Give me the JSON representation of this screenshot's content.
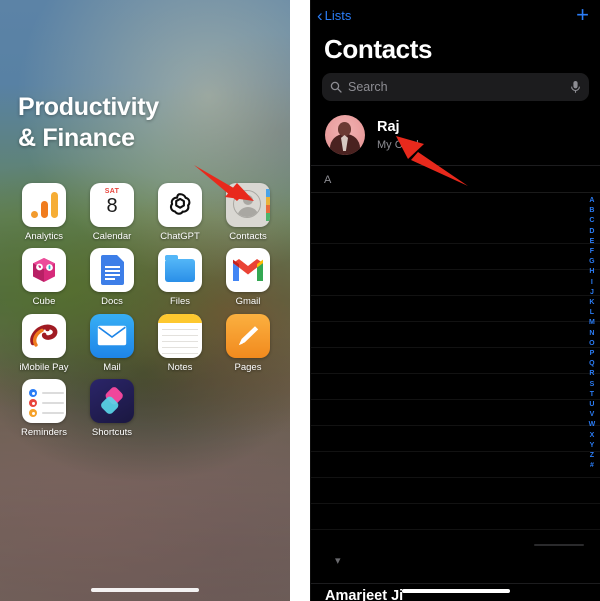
{
  "home": {
    "folder_title": "Productivity\n& Finance",
    "apps": [
      {
        "label": "Analytics",
        "icon": "analytics-icon"
      },
      {
        "label": "Calendar",
        "icon": "calendar-icon",
        "weekday": "SAT",
        "day": "8"
      },
      {
        "label": "ChatGPT",
        "icon": "chatgpt-icon"
      },
      {
        "label": "Contacts",
        "icon": "contacts-icon"
      },
      {
        "label": "Cube",
        "icon": "cube-icon"
      },
      {
        "label": "Docs",
        "icon": "docs-icon"
      },
      {
        "label": "Files",
        "icon": "files-icon"
      },
      {
        "label": "Gmail",
        "icon": "gmail-icon"
      },
      {
        "label": "iMobile Pay",
        "icon": "imobile-pay-icon"
      },
      {
        "label": "Mail",
        "icon": "mail-icon"
      },
      {
        "label": "Notes",
        "icon": "notes-icon"
      },
      {
        "label": "Pages",
        "icon": "pages-icon"
      },
      {
        "label": "Reminders",
        "icon": "reminders-icon"
      },
      {
        "label": "Shortcuts",
        "icon": "shortcuts-icon"
      }
    ]
  },
  "contacts": {
    "back_label": "Lists",
    "add_label": "+",
    "title": "Contacts",
    "search": {
      "placeholder": "Search",
      "value": "",
      "mic_icon": "microphone-icon",
      "search_icon": "search-icon"
    },
    "my_card": {
      "name": "Raj",
      "subtitle": "My Card"
    },
    "section_header": "A",
    "index_letters": "ABCDEFGHIJKLMNOPQRSTUVWXYZ#",
    "partial_contact": "Amarjeet Ji"
  },
  "annotations": {
    "arrow_color": "#e8291c",
    "arrow_1_target": "Contacts app icon",
    "arrow_2_target": "Raj my-card row"
  },
  "colors": {
    "accent_blue": "#2b7df6",
    "arrow_red": "#e8291c",
    "dark_bg": "#000000",
    "secondary_text": "#8d8d93"
  }
}
